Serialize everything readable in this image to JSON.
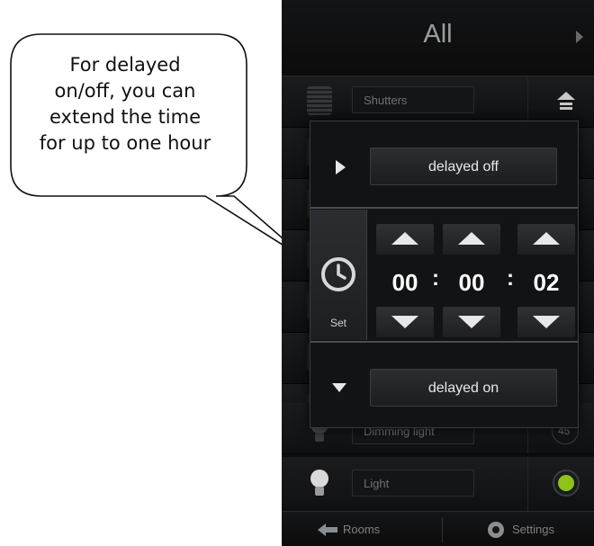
{
  "callout": {
    "lines": [
      "For delayed",
      "on/off, you can",
      "extend the time",
      "for up to one hour"
    ]
  },
  "header": {
    "title": "All"
  },
  "rows": [
    {
      "label": "Shutters"
    },
    {
      "label": ""
    },
    {
      "label": ""
    },
    {
      "label": ""
    },
    {
      "label": ""
    },
    {
      "label": ""
    },
    {
      "label": ""
    },
    {
      "label": "Dimming light",
      "value": "45"
    },
    {
      "label": "Light"
    }
  ],
  "popup": {
    "delayed_off_label": "delayed off",
    "delayed_on_label": "delayed on",
    "set_label": "Set",
    "hours": "00",
    "minutes": "00",
    "seconds": "02",
    "separator": ":"
  },
  "bottom_bar": {
    "rooms_label": "Rooms",
    "settings_label": "Settings"
  },
  "colors": {
    "light_indicator": "#8cc21a",
    "accent_text": "#e9e9e9",
    "background": "#0d0d0e"
  },
  "icons": [
    "next-arrow-icon",
    "shutters-icon",
    "home-up-icon",
    "bulb-icon",
    "timer-icon",
    "back-arrow-icon",
    "gear-icon"
  ]
}
